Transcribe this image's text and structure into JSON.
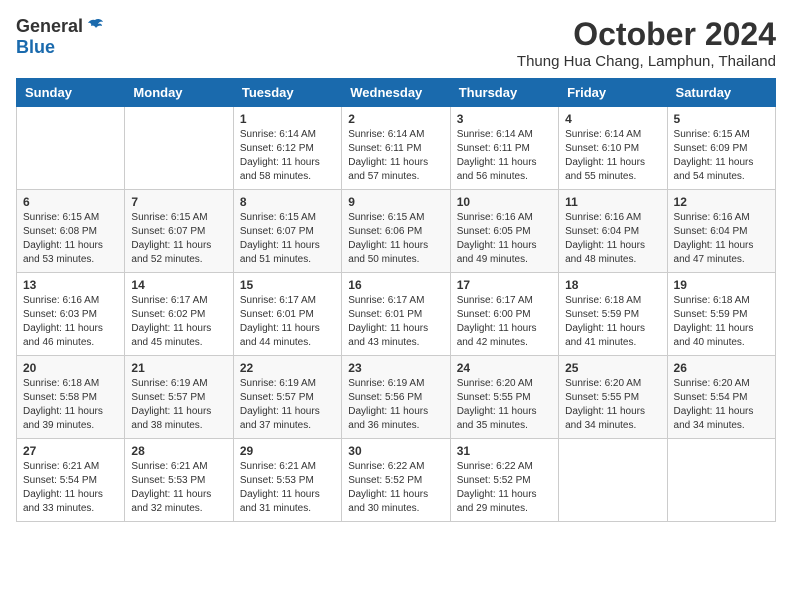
{
  "logo": {
    "general": "General",
    "blue": "Blue"
  },
  "header": {
    "month": "October 2024",
    "location": "Thung Hua Chang, Lamphun, Thailand"
  },
  "weekdays": [
    "Sunday",
    "Monday",
    "Tuesday",
    "Wednesday",
    "Thursday",
    "Friday",
    "Saturday"
  ],
  "weeks": [
    [
      {
        "day": "",
        "info": ""
      },
      {
        "day": "",
        "info": ""
      },
      {
        "day": "1",
        "info": "Sunrise: 6:14 AM\nSunset: 6:12 PM\nDaylight: 11 hours and 58 minutes."
      },
      {
        "day": "2",
        "info": "Sunrise: 6:14 AM\nSunset: 6:11 PM\nDaylight: 11 hours and 57 minutes."
      },
      {
        "day": "3",
        "info": "Sunrise: 6:14 AM\nSunset: 6:11 PM\nDaylight: 11 hours and 56 minutes."
      },
      {
        "day": "4",
        "info": "Sunrise: 6:14 AM\nSunset: 6:10 PM\nDaylight: 11 hours and 55 minutes."
      },
      {
        "day": "5",
        "info": "Sunrise: 6:15 AM\nSunset: 6:09 PM\nDaylight: 11 hours and 54 minutes."
      }
    ],
    [
      {
        "day": "6",
        "info": "Sunrise: 6:15 AM\nSunset: 6:08 PM\nDaylight: 11 hours and 53 minutes."
      },
      {
        "day": "7",
        "info": "Sunrise: 6:15 AM\nSunset: 6:07 PM\nDaylight: 11 hours and 52 minutes."
      },
      {
        "day": "8",
        "info": "Sunrise: 6:15 AM\nSunset: 6:07 PM\nDaylight: 11 hours and 51 minutes."
      },
      {
        "day": "9",
        "info": "Sunrise: 6:15 AM\nSunset: 6:06 PM\nDaylight: 11 hours and 50 minutes."
      },
      {
        "day": "10",
        "info": "Sunrise: 6:16 AM\nSunset: 6:05 PM\nDaylight: 11 hours and 49 minutes."
      },
      {
        "day": "11",
        "info": "Sunrise: 6:16 AM\nSunset: 6:04 PM\nDaylight: 11 hours and 48 minutes."
      },
      {
        "day": "12",
        "info": "Sunrise: 6:16 AM\nSunset: 6:04 PM\nDaylight: 11 hours and 47 minutes."
      }
    ],
    [
      {
        "day": "13",
        "info": "Sunrise: 6:16 AM\nSunset: 6:03 PM\nDaylight: 11 hours and 46 minutes."
      },
      {
        "day": "14",
        "info": "Sunrise: 6:17 AM\nSunset: 6:02 PM\nDaylight: 11 hours and 45 minutes."
      },
      {
        "day": "15",
        "info": "Sunrise: 6:17 AM\nSunset: 6:01 PM\nDaylight: 11 hours and 44 minutes."
      },
      {
        "day": "16",
        "info": "Sunrise: 6:17 AM\nSunset: 6:01 PM\nDaylight: 11 hours and 43 minutes."
      },
      {
        "day": "17",
        "info": "Sunrise: 6:17 AM\nSunset: 6:00 PM\nDaylight: 11 hours and 42 minutes."
      },
      {
        "day": "18",
        "info": "Sunrise: 6:18 AM\nSunset: 5:59 PM\nDaylight: 11 hours and 41 minutes."
      },
      {
        "day": "19",
        "info": "Sunrise: 6:18 AM\nSunset: 5:59 PM\nDaylight: 11 hours and 40 minutes."
      }
    ],
    [
      {
        "day": "20",
        "info": "Sunrise: 6:18 AM\nSunset: 5:58 PM\nDaylight: 11 hours and 39 minutes."
      },
      {
        "day": "21",
        "info": "Sunrise: 6:19 AM\nSunset: 5:57 PM\nDaylight: 11 hours and 38 minutes."
      },
      {
        "day": "22",
        "info": "Sunrise: 6:19 AM\nSunset: 5:57 PM\nDaylight: 11 hours and 37 minutes."
      },
      {
        "day": "23",
        "info": "Sunrise: 6:19 AM\nSunset: 5:56 PM\nDaylight: 11 hours and 36 minutes."
      },
      {
        "day": "24",
        "info": "Sunrise: 6:20 AM\nSunset: 5:55 PM\nDaylight: 11 hours and 35 minutes."
      },
      {
        "day": "25",
        "info": "Sunrise: 6:20 AM\nSunset: 5:55 PM\nDaylight: 11 hours and 34 minutes."
      },
      {
        "day": "26",
        "info": "Sunrise: 6:20 AM\nSunset: 5:54 PM\nDaylight: 11 hours and 34 minutes."
      }
    ],
    [
      {
        "day": "27",
        "info": "Sunrise: 6:21 AM\nSunset: 5:54 PM\nDaylight: 11 hours and 33 minutes."
      },
      {
        "day": "28",
        "info": "Sunrise: 6:21 AM\nSunset: 5:53 PM\nDaylight: 11 hours and 32 minutes."
      },
      {
        "day": "29",
        "info": "Sunrise: 6:21 AM\nSunset: 5:53 PM\nDaylight: 11 hours and 31 minutes."
      },
      {
        "day": "30",
        "info": "Sunrise: 6:22 AM\nSunset: 5:52 PM\nDaylight: 11 hours and 30 minutes."
      },
      {
        "day": "31",
        "info": "Sunrise: 6:22 AM\nSunset: 5:52 PM\nDaylight: 11 hours and 29 minutes."
      },
      {
        "day": "",
        "info": ""
      },
      {
        "day": "",
        "info": ""
      }
    ]
  ]
}
